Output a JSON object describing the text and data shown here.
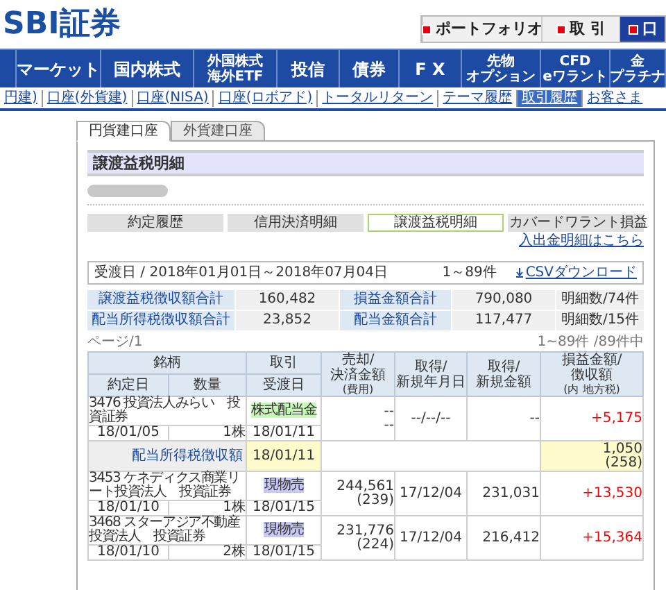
{
  "logo": "SBI証券",
  "top_buttons": [
    {
      "label": "ポートフォリオ",
      "selected": false
    },
    {
      "label": "取 引",
      "selected": false
    },
    {
      "label": "口",
      "selected": true
    }
  ],
  "nav": [
    {
      "lines": [
        "マーケット"
      ]
    },
    {
      "lines": [
        "国内株式"
      ]
    },
    {
      "lines": [
        "外国株式",
        "海外ETF"
      ]
    },
    {
      "lines": [
        "投信"
      ]
    },
    {
      "lines": [
        "債券"
      ]
    },
    {
      "lines": [
        "F X"
      ]
    },
    {
      "lines": [
        "先物",
        "オプション"
      ]
    },
    {
      "lines": [
        "CFD",
        "eワラント"
      ]
    },
    {
      "lines": [
        "金",
        "プラチナ"
      ]
    }
  ],
  "sub_links": [
    {
      "label": "円建)",
      "selected": false
    },
    {
      "label": "口座(外貨建)",
      "selected": false
    },
    {
      "label": "口座(NISA)",
      "selected": false
    },
    {
      "label": "口座(ロボアド)",
      "selected": false
    },
    {
      "label": "トータルリターン",
      "selected": false
    },
    {
      "label": "テーマ履歴",
      "selected": false
    },
    {
      "label": "取引履歴",
      "selected": true
    },
    {
      "label": "お客さま",
      "selected": false
    }
  ],
  "account_tabs": [
    {
      "label": "円貨建口座",
      "selected": true
    },
    {
      "label": "外貨建口座",
      "selected": false
    }
  ],
  "section_title": "譲渡益税明細",
  "history_tabs": [
    {
      "label": "約定履歴",
      "selected": false
    },
    {
      "label": "信用決済明細",
      "selected": false
    },
    {
      "label": "譲渡益税明細",
      "selected": true
    },
    {
      "label": "カバードワラント損益",
      "selected": false
    }
  ],
  "deposit_link": "入出金明細はこちら",
  "filter": {
    "period": "受渡日 / 2018年01月01日～2018年07月04日",
    "count": "1～89件",
    "csv_link": "CSVダウンロード"
  },
  "summary": [
    {
      "label": "譲渡益税徴収額合計",
      "value": "160,482",
      "label2": "損益金額合計",
      "value2": "790,080",
      "detail": "明細数/74件"
    },
    {
      "label": "配当所得税徴収額合計",
      "value": "23,852",
      "label2": "配当金額合計",
      "value2": "117,477",
      "detail": "明細数/15件"
    }
  ],
  "page": "ページ/1",
  "range": "1~89件 /89件中",
  "table": {
    "headers": {
      "name": "銘柄",
      "trade": "取引",
      "sale": [
        "売却/",
        "決済金額"
      ],
      "sale_note": "(費用)",
      "acq_date": [
        "取得/",
        "新規年月日"
      ],
      "acq_amount": [
        "取得/",
        "新規金額"
      ],
      "profit": [
        "損益金額/",
        "徴収額"
      ],
      "profit_note": "(内 地方税)",
      "trade_date": "約定日",
      "quantity": "数量",
      "delivery": "受渡日"
    },
    "rows": [
      {
        "kind": "trade",
        "name": "3476 投資法人みらい　投資証券",
        "type": {
          "label": "株式配当金",
          "kind": "dividend"
        },
        "trade_date": "18/01/05",
        "quantity": "1株",
        "delivery": "18/01/11",
        "sale": "--",
        "fee": "--",
        "acq_date": "--/--/--",
        "acq_amount": "--",
        "profit": "+5,175"
      },
      {
        "kind": "tax",
        "label": "配当所得税徴収額",
        "date": "18/01/11",
        "amount": "1,050",
        "local": "(258)"
      },
      {
        "kind": "trade",
        "name": "3453 ケネディクス商業リート投資法人　投資証券",
        "type": {
          "label": "現物売",
          "kind": "sale"
        },
        "trade_date": "18/01/10",
        "quantity": "1株",
        "delivery": "18/01/15",
        "sale": "244,561",
        "fee": "(239)",
        "acq_date": "17/12/04",
        "acq_amount": "231,031",
        "profit": "+13,530"
      },
      {
        "kind": "trade",
        "name": "3468 スターアジア不動産投資法人　投資証券",
        "type": {
          "label": "現物売",
          "kind": "sale"
        },
        "trade_date": "18/01/10",
        "quantity": "2株",
        "delivery": "18/01/15",
        "sale": "231,776",
        "fee": "(224)",
        "acq_date": "17/12/04",
        "acq_amount": "216,412",
        "profit": "+15,364"
      }
    ]
  }
}
